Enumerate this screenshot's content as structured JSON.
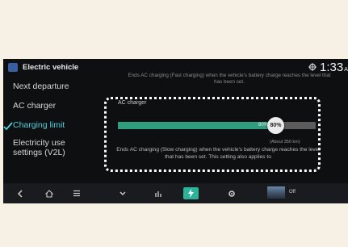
{
  "app": {
    "title": "Electric vehicle"
  },
  "status": {
    "time": "1:33",
    "ampm": "AM"
  },
  "sidebar": {
    "items": [
      {
        "label": "Next departure"
      },
      {
        "label": "AC charger"
      },
      {
        "label": "Charging limit",
        "active": true
      },
      {
        "label": "Electricity use settings (V2L)"
      }
    ]
  },
  "main": {
    "top_text": "Ends AC charging (Fast charging) when the vehicle's battery charge reaches the level that has been set.",
    "card_title": "AC charger",
    "slider": {
      "value_percent": 80,
      "fill_label": "80%",
      "thumb_label": "80%"
    },
    "range_label": "(About 356 km)",
    "description": "Ends AC charging (Slow charging) when the vehicle's battery charge reaches the level that has been set. This setting also applies to"
  },
  "navbar": {
    "media_label": "Off"
  },
  "colors": {
    "accent": "#4ccfe0",
    "fill": "#2e9e7f",
    "nav_active": "#2bb49a"
  },
  "icons": [
    "ev-app-icon",
    "gps-icon",
    "check-icon",
    "back-icon",
    "home-icon",
    "menu-icon",
    "collapse-icon",
    "stats-icon",
    "charging-icon",
    "settings-icon"
  ]
}
